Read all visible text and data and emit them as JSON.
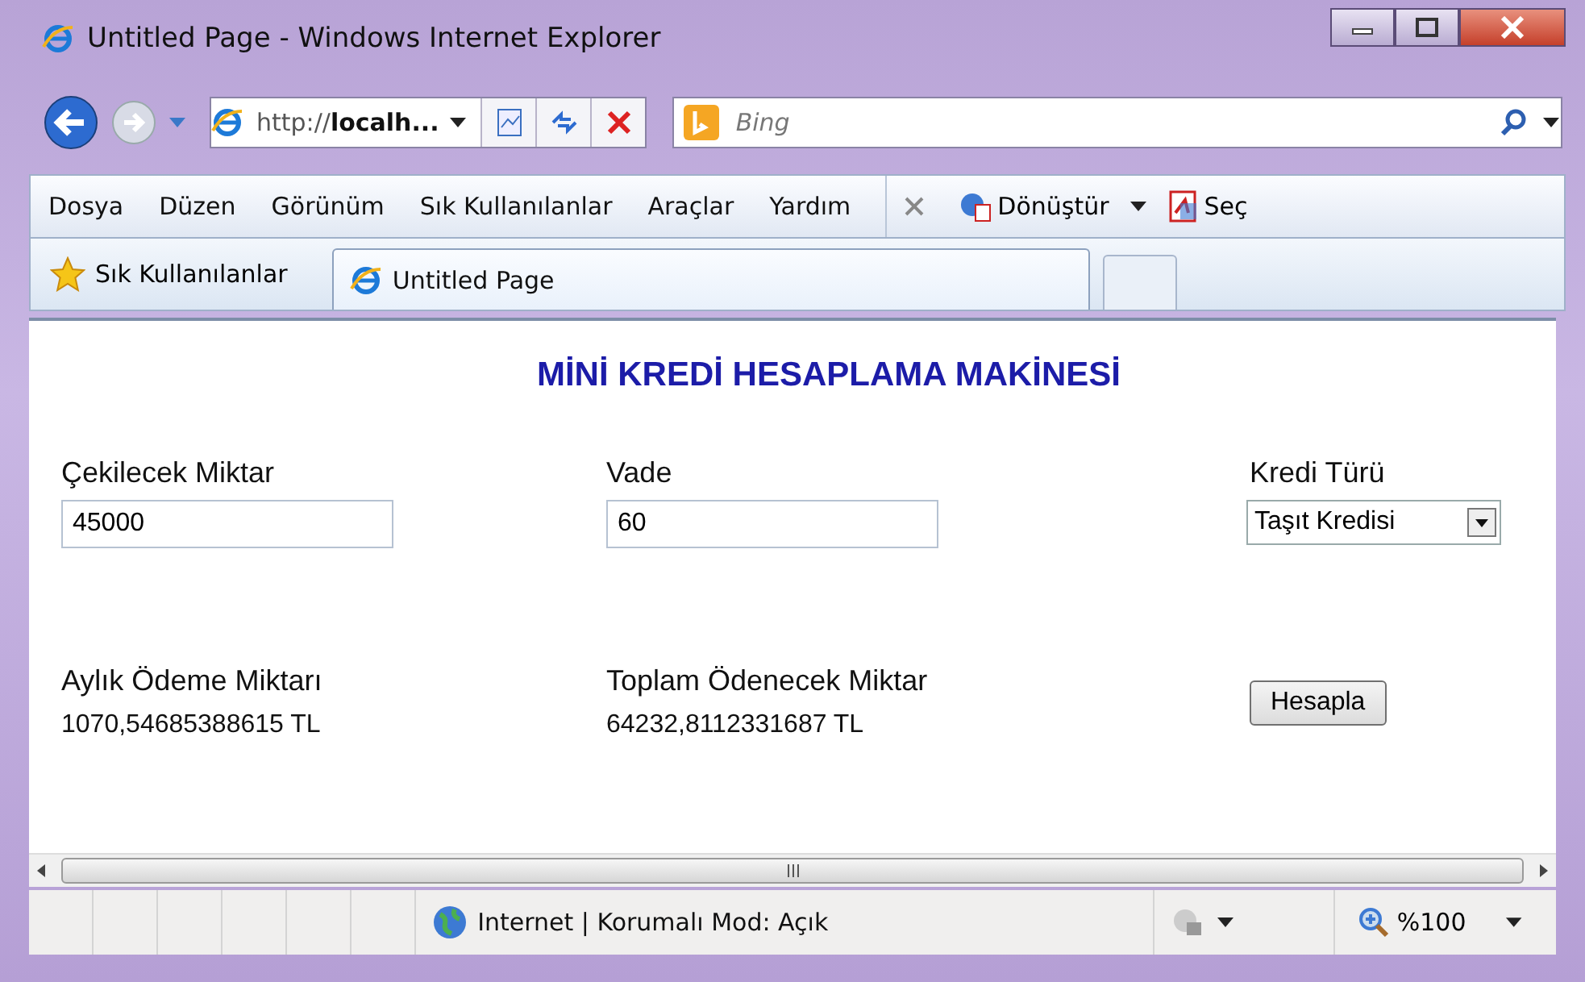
{
  "window": {
    "title": "Untitled Page - Windows Internet Explorer"
  },
  "address_bar": {
    "url": "http://**localh...**"
  },
  "search": {
    "placeholder": "Bing"
  },
  "menu": [
    "Dosya",
    "Düzen",
    "Görünüm",
    "Sık Kullanılanlar",
    "Araçlar",
    "Yardım"
  ],
  "command_bar": [
    "Dönüştür",
    "Seç"
  ],
  "favorites": {
    "label": "Sık Kullanılanlar"
  },
  "tabs": [
    {
      "label": "Untitled Page",
      "selected": true
    }
  ],
  "page": {
    "heading": "MİNİ KREDİ HESAPLAMA MAKİNESİ",
    "fields": [
      {
        "label": "Çekilecek Miktar",
        "kind": "input",
        "value": "45000"
      },
      {
        "label": "Vade",
        "kind": "input",
        "value": "60"
      },
      {
        "label": "Kredi Türü",
        "kind": "select",
        "value": "Taşıt Kredisi"
      }
    ],
    "results": [
      {
        "label": "Aylık Ödeme Miktarı",
        "value": "1070,54685388615 TL"
      },
      {
        "label": "Toplam Ödenecek Miktar",
        "value": "64232,8112331687 TL"
      }
    ],
    "button": "Hesapla"
  },
  "status_bar": {
    "zone": "Internet | Korumalı Mod: Açık",
    "zoom": "%100"
  }
}
